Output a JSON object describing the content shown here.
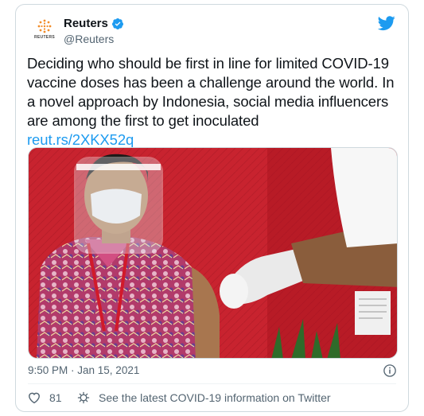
{
  "author": {
    "name": "Reuters",
    "handle": "@Reuters",
    "logo_word": "REUTERS"
  },
  "tweet": {
    "text": "Deciding who should be first in line for limited COVID-19 vaccine doses has been a challenge around the world. In a novel approach by Indonesia, social media influencers are among the first to get inoculated",
    "link": "reut.rs/2XKX52q",
    "timestamp": "9:50 PM · Jan 15, 2021"
  },
  "actions": {
    "like_count": "81",
    "covid_info": "See the latest COVID-19 information on Twitter"
  },
  "colors": {
    "link": "#1d9bf0",
    "muted": "#536471",
    "border": "#cfd9de",
    "brand_orange": "#f28c28"
  },
  "icons": [
    "verified-badge-icon",
    "twitter-bird-icon",
    "info-icon",
    "heart-icon",
    "covid-info-icon"
  ]
}
